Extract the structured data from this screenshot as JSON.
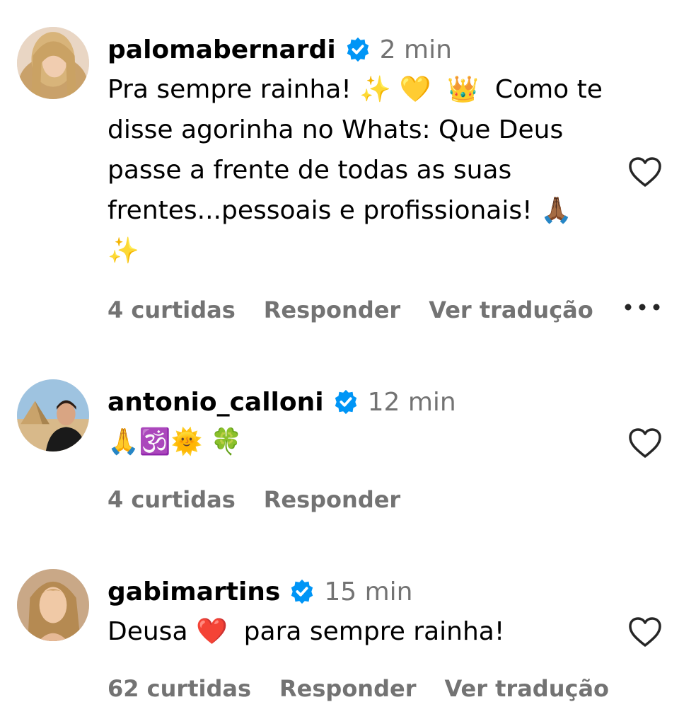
{
  "colors": {
    "verified_blue": "#0095f6",
    "meta_gray": "#737373",
    "text": "#000000"
  },
  "comments": [
    {
      "username": "palomabernardi",
      "verified": true,
      "time": "2 min",
      "text": "Pra sempre rainha! ✨ 💛  👑  Como te disse agorinha no Whats: Que Deus passe a frente de todas as suas frentes...pessoais e profissionais! 🙏🏾 ✨",
      "likes": "4 curtidas",
      "reply_label": "Responder",
      "translate_label": "Ver tradução",
      "has_more_menu": true,
      "heart_icon": "heart-outline-icon"
    },
    {
      "username": "antonio_calloni",
      "verified": true,
      "time": "12 min",
      "text": "🙏🕉️🌞 🍀",
      "likes": "4 curtidas",
      "reply_label": "Responder",
      "heart_icon": "heart-outline-icon"
    },
    {
      "username": "gabimartins",
      "verified": true,
      "time": "15 min",
      "text": "Deusa ❤️  para sempre rainha!",
      "likes": "62 curtidas",
      "reply_label": "Responder",
      "translate_label": "Ver tradução",
      "heart_icon": "heart-outline-icon"
    }
  ]
}
